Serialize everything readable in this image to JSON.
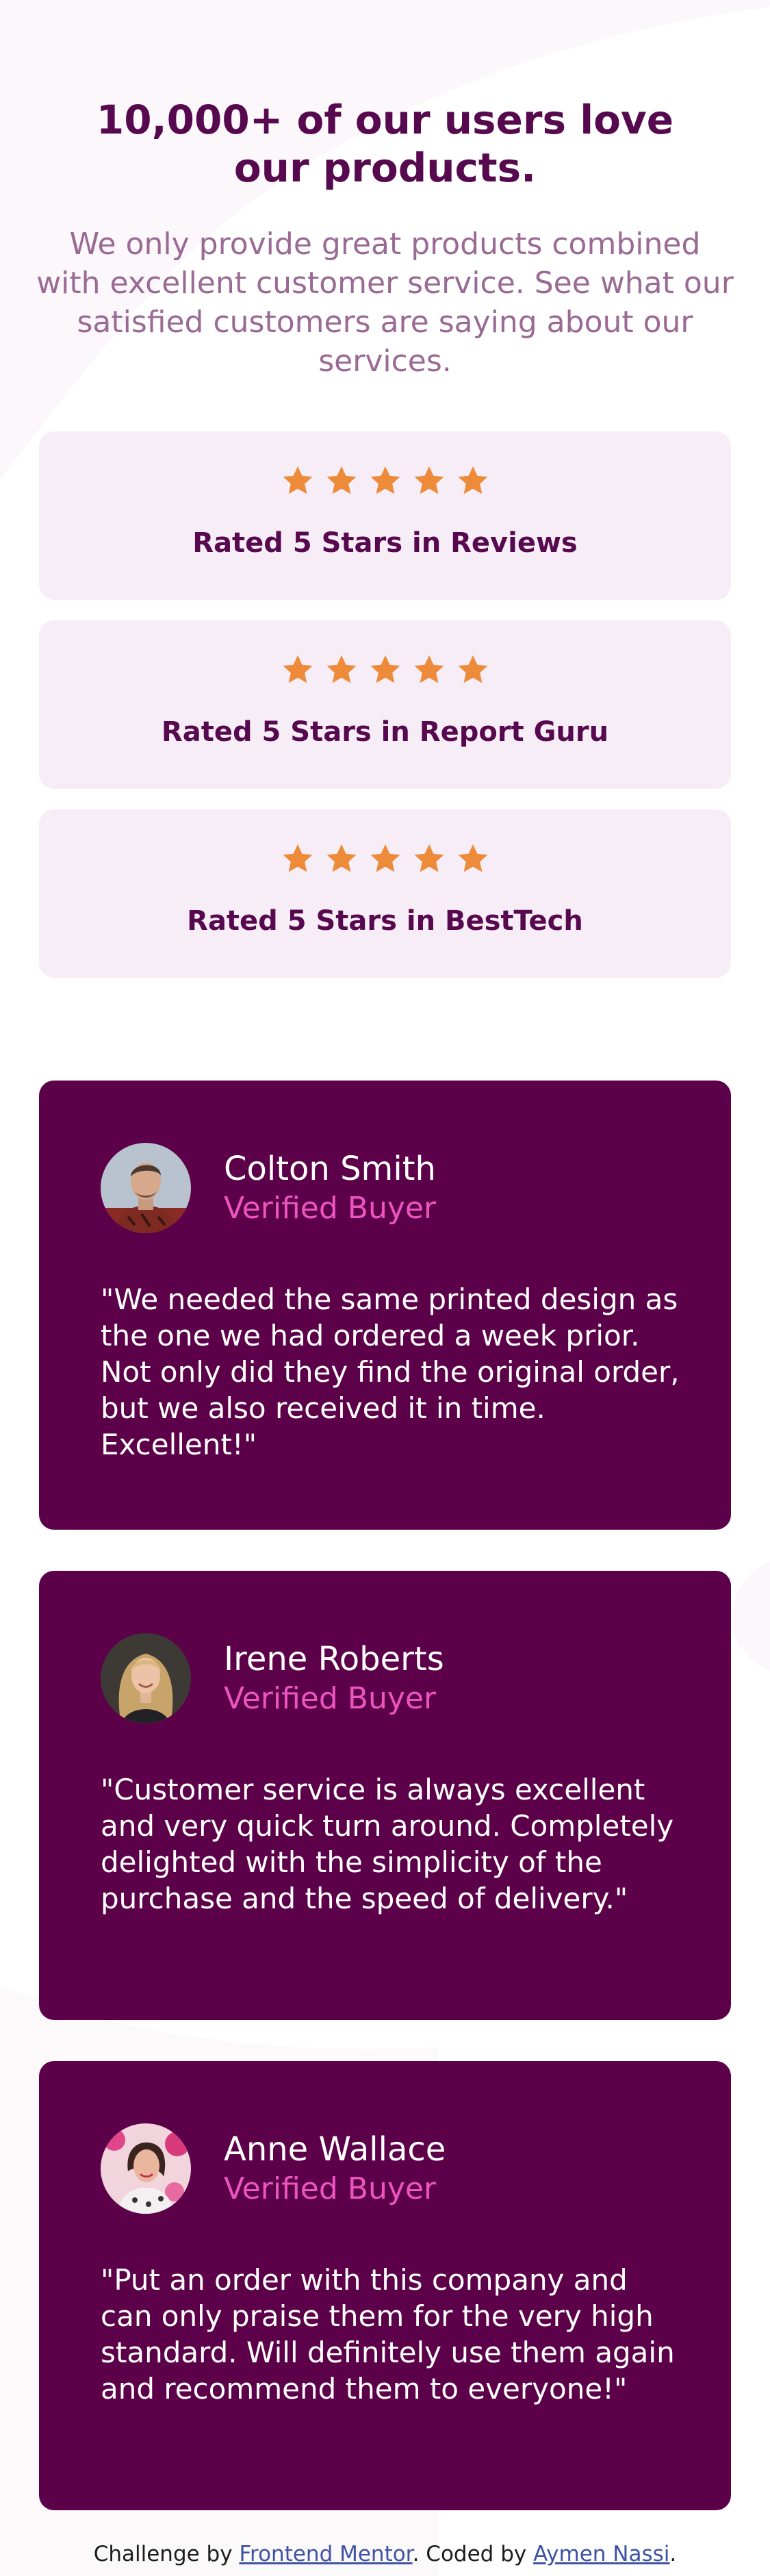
{
  "hero": {
    "title": "10,000+ of our users love our products.",
    "description": "We only provide great products combined with excellent customer service. See what our satisfied customers are saying about our services."
  },
  "ratings": [
    {
      "label": "Rated 5 Stars in Reviews",
      "stars": 5
    },
    {
      "label": "Rated 5 Stars in Report Guru",
      "stars": 5
    },
    {
      "label": "Rated 5 Stars in BestTech",
      "stars": 5
    }
  ],
  "testimonials": [
    {
      "name": "Colton Smith",
      "badge": "Verified Buyer",
      "quote": "\"We needed the same printed design as the one we had ordered a week prior. Not only did they find the original order, but we also received it in time. Excellent!\""
    },
    {
      "name": "Irene Roberts",
      "badge": "Verified Buyer",
      "quote": "\"Customer service is always excellent and very quick turn around. Completely delighted with the simplicity of the purchase and the speed of delivery.\""
    },
    {
      "name": "Anne Wallace",
      "badge": "Verified Buyer",
      "quote": "\"Put an order with this company and can only praise them for the very high standard. Will definitely use them again and recommend them to everyone!\""
    }
  ],
  "footer": {
    "prefix": "Challenge by ",
    "challenge_link": "Frontend Mentor",
    "middle": ". Coded by ",
    "author_link": "Aymen Nassi",
    "suffix": "."
  },
  "colors": {
    "primary": "#56094e",
    "card_bg": "#5c0149",
    "rating_bg": "#f7edf6",
    "star": "#ee8b3a",
    "accent_pink": "#ec55be"
  }
}
